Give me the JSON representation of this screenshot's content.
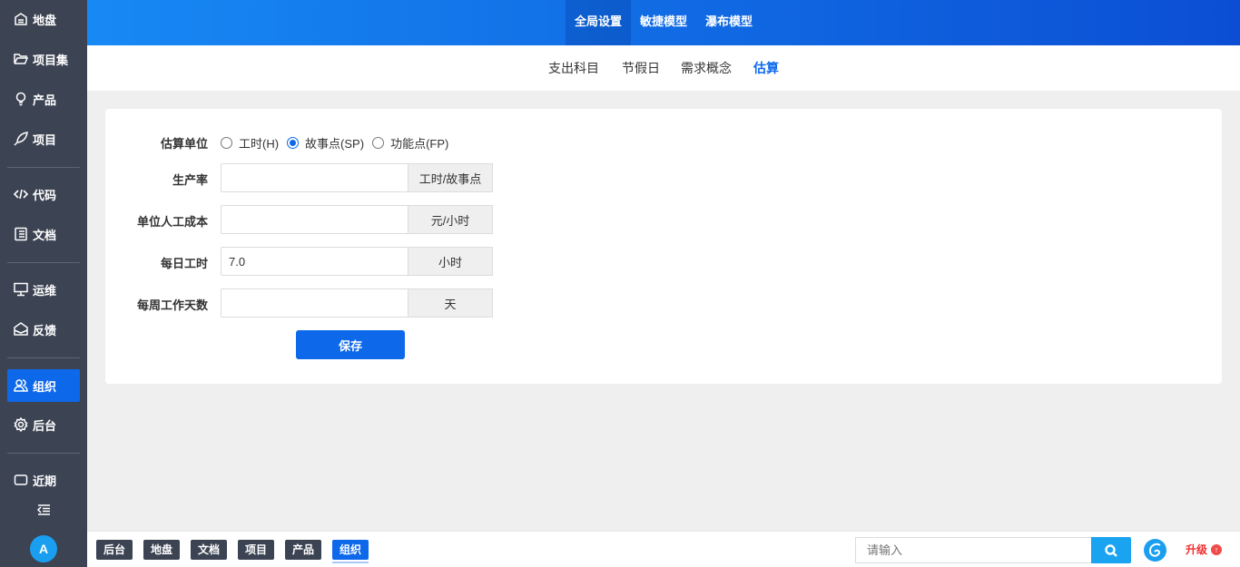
{
  "sidebar": {
    "items": [
      {
        "label": "地盘",
        "icon": "dashboard-icon"
      },
      {
        "label": "项目集",
        "icon": "folder-icon"
      },
      {
        "label": "产品",
        "icon": "lightbulb-icon"
      },
      {
        "label": "项目",
        "icon": "rocket-icon"
      },
      {
        "label": "代码",
        "icon": "code-icon"
      },
      {
        "label": "文档",
        "icon": "document-icon"
      },
      {
        "label": "运维",
        "icon": "ops-icon"
      },
      {
        "label": "反馈",
        "icon": "feedback-icon"
      },
      {
        "label": "组织",
        "icon": "users-icon"
      },
      {
        "label": "后台",
        "icon": "gear-icon"
      },
      {
        "label": "近期",
        "icon": "recent-icon"
      }
    ],
    "active": "组织",
    "avatar": "A"
  },
  "topnav": {
    "tabs": [
      "全局设置",
      "敏捷模型",
      "瀑布模型"
    ],
    "active": "全局设置"
  },
  "subnav": {
    "items": [
      "支出科目",
      "节假日",
      "需求概念",
      "估算"
    ],
    "active": "估算"
  },
  "form": {
    "unit_label": "估算单位",
    "unit_options": [
      "工时(H)",
      "故事点(SP)",
      "功能点(FP)"
    ],
    "unit_selected": "故事点(SP)",
    "fields": [
      {
        "label": "生产率",
        "value": "",
        "addon": "工时/故事点"
      },
      {
        "label": "单位人工成本",
        "value": "",
        "addon": "元/小时"
      },
      {
        "label": "每日工时",
        "value": "7.0",
        "addon": "小时"
      },
      {
        "label": "每周工作天数",
        "value": "",
        "addon": "天"
      }
    ],
    "save_label": "保存"
  },
  "bottombar": {
    "tabs": [
      "后台",
      "地盘",
      "文档",
      "项目",
      "产品",
      "组织"
    ],
    "active": "组织",
    "search_placeholder": "请输入",
    "upgrade_label": "升级"
  },
  "colors": {
    "accent": "#0e68ea",
    "sidebar": "#3c4353",
    "upgrade": "#f02d2d"
  }
}
